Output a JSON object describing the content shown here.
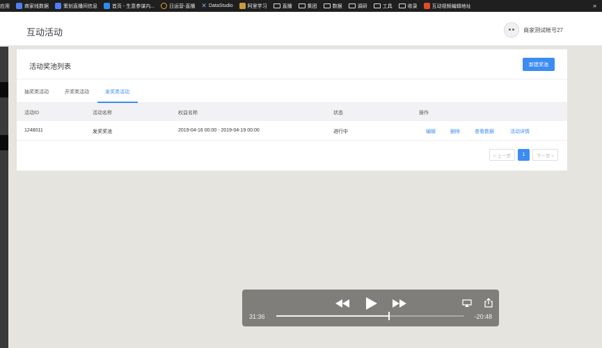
{
  "bookmarks": {
    "items": [
      {
        "label": "应用",
        "icon": "apps-icon",
        "color": ""
      },
      {
        "label": "商家线数据",
        "icon": "doc-icon",
        "color": "#4f7df5"
      },
      {
        "label": "策划直播间信息",
        "icon": "doc-icon",
        "color": "#4f7df5"
      },
      {
        "label": "首页 - 生意参谋内...",
        "icon": "site-icon",
        "color": "#2d8cf0"
      },
      {
        "label": "日运营-直播",
        "icon": "ring-icon",
        "color": "#f0a030"
      },
      {
        "label": "DataStudio",
        "icon": "x-icon",
        "color": "#6fb3ff"
      },
      {
        "label": "阿里学习",
        "icon": "app-icon",
        "color": "#c99a3c"
      },
      {
        "label": "直播",
        "icon": "folder-icon",
        "color": ""
      },
      {
        "label": "集团",
        "icon": "folder-icon",
        "color": ""
      },
      {
        "label": "数据",
        "icon": "folder-icon",
        "color": ""
      },
      {
        "label": "调研",
        "icon": "folder-icon",
        "color": ""
      },
      {
        "label": "工具",
        "icon": "folder-icon",
        "color": ""
      },
      {
        "label": "收录",
        "icon": "folder-icon",
        "color": ""
      },
      {
        "label": "互动视频编辑地址",
        "icon": "site-icon",
        "color": "#e24a2a"
      }
    ],
    "more": "»"
  },
  "header": {
    "title": "互动活动",
    "username": "商家测试帐号27"
  },
  "card": {
    "title": "活动奖池列表",
    "new_button": "新建奖池",
    "tabs": [
      {
        "label": "抽奖类活动",
        "active": false
      },
      {
        "label": "开奖类活动",
        "active": false
      },
      {
        "label": "发奖类活动",
        "active": true
      }
    ],
    "columns": [
      "活动ID",
      "活动名称",
      "权益名称",
      "状态",
      "操作"
    ],
    "rows": [
      {
        "id": "1248011",
        "name": "发奖奖池",
        "benefit": "2019-04-16 00:00 - 2019-04-19 00:00",
        "status": "进行中",
        "ops": [
          "编辑",
          "删除",
          "查看数据",
          "活动详情"
        ]
      }
    ],
    "pager": {
      "prev": "< 上一页",
      "page": "1",
      "next": "下一页 >"
    }
  },
  "player": {
    "elapsed": "31:36",
    "remaining": "-20:48",
    "progress": 0.6
  },
  "colors": {
    "accent": "#3c8cf2"
  }
}
